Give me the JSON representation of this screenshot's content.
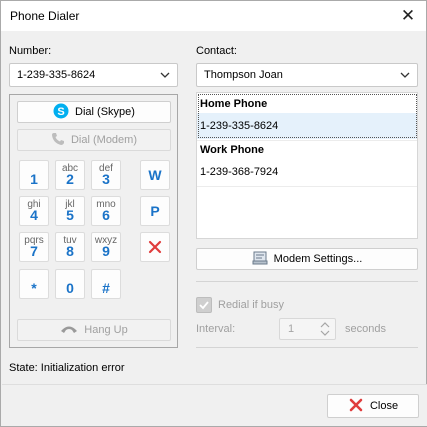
{
  "window": {
    "title": "Phone Dialer"
  },
  "number": {
    "label": "Number:",
    "value": "1-239-335-8624"
  },
  "contact": {
    "label": "Contact:",
    "value": "Thompson Joan"
  },
  "buttons": {
    "dial_skype": "Dial (Skype)",
    "dial_modem": "Dial (Modem)",
    "hang_up": "Hang Up",
    "modem_settings": "Modem Settings...",
    "close": "Close"
  },
  "keypad": {
    "keys": [
      {
        "sub": "",
        "main": "1"
      },
      {
        "sub": "abc",
        "main": "2"
      },
      {
        "sub": "def",
        "main": "3"
      },
      {
        "sub": "ghi",
        "main": "4"
      },
      {
        "sub": "jkl",
        "main": "5"
      },
      {
        "sub": "mno",
        "main": "6"
      },
      {
        "sub": "pqrs",
        "main": "7"
      },
      {
        "sub": "tuv",
        "main": "8"
      },
      {
        "sub": "wxyz",
        "main": "9"
      },
      {
        "sub": "",
        "main": "*"
      },
      {
        "sub": "",
        "main": "0"
      },
      {
        "sub": "",
        "main": "#"
      }
    ],
    "side": [
      "W",
      "P"
    ]
  },
  "phones": [
    {
      "label": "Home Phone",
      "number": "1-239-335-8624"
    },
    {
      "label": "Work Phone",
      "number": "1-239-368-7924"
    }
  ],
  "redial": {
    "label": "Redial if busy",
    "checked": true,
    "enabled": false
  },
  "interval": {
    "label": "Interval:",
    "value": "1",
    "unit": "seconds"
  },
  "status": {
    "text": "State: Initialization error"
  },
  "colors": {
    "accent": "#1a73c8",
    "error": "#e03c3c",
    "skype": "#00aff0"
  }
}
